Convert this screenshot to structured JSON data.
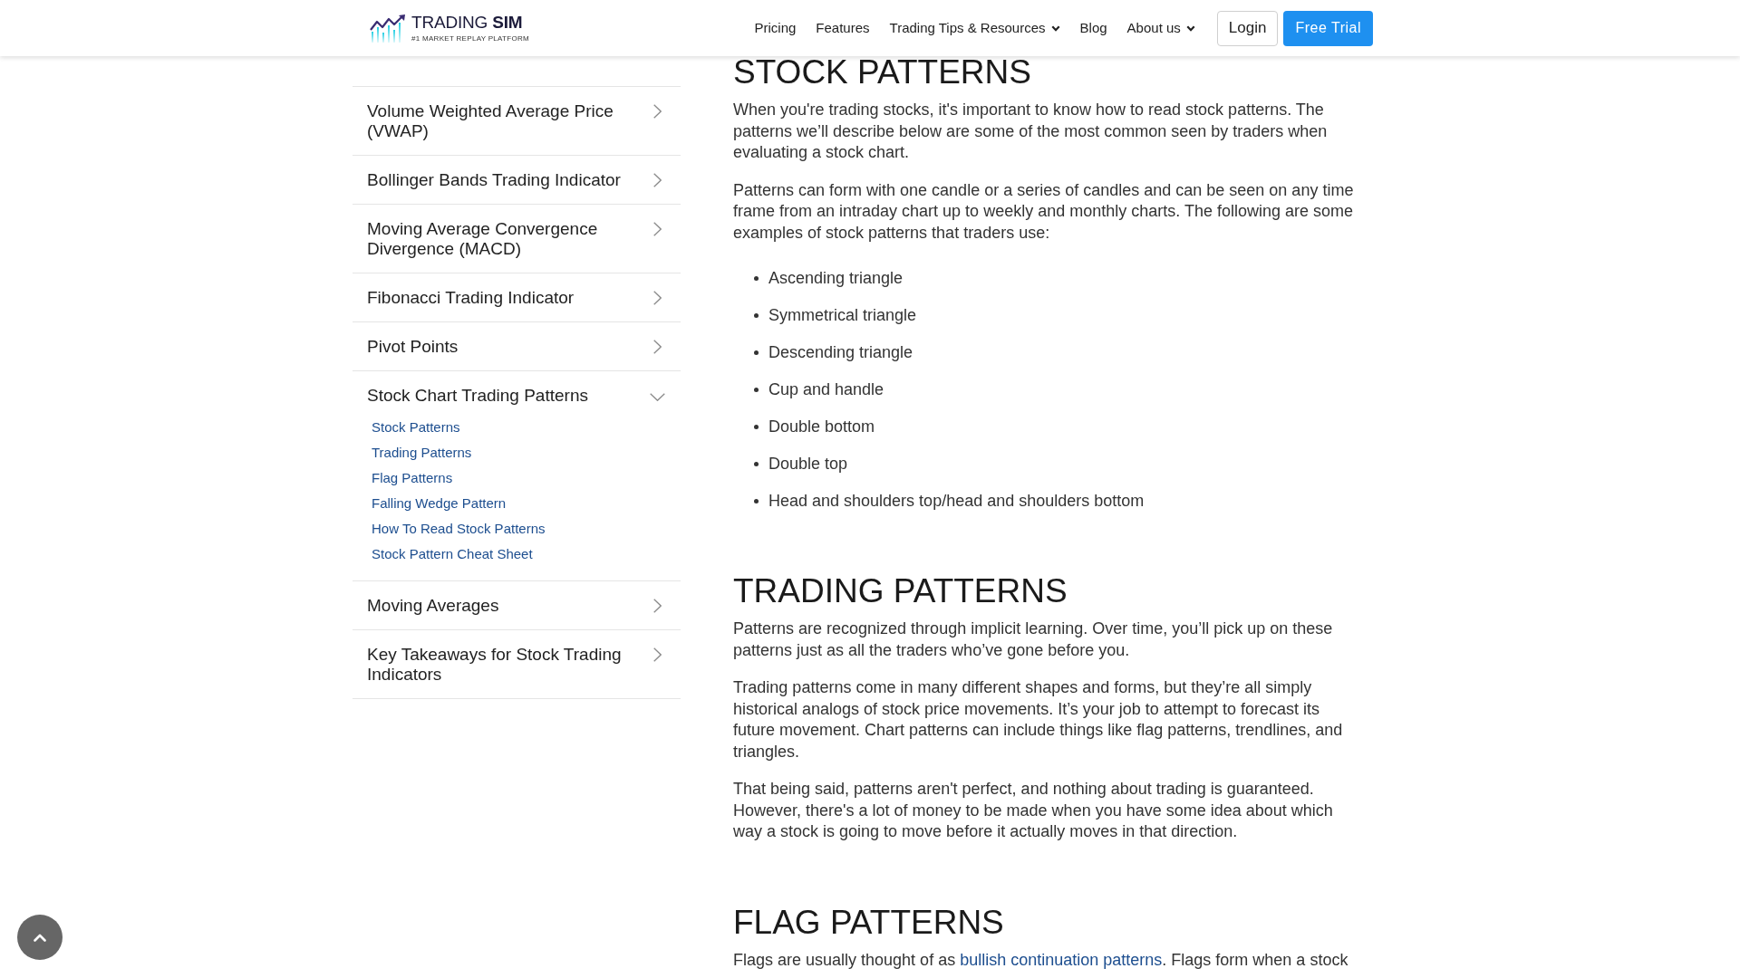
{
  "header": {
    "logo": {
      "wordmark": "TRADING **SIM**",
      "tagline": "#1 MARKET REPLAY PLATFORM"
    },
    "nav": [
      {
        "label": "Pricing",
        "kind": "link"
      },
      {
        "label": "Features",
        "kind": "link"
      },
      {
        "label": "Trading Tips & Resources",
        "kind": "dropdown"
      },
      {
        "label": "Blog",
        "kind": "link"
      },
      {
        "label": "About us",
        "kind": "dropdown"
      }
    ],
    "buttons": [
      {
        "label": "Login",
        "kind": "outline"
      },
      {
        "label": "Free Trial",
        "kind": "filled"
      }
    ]
  },
  "sidebar": {
    "items": [
      {
        "label": "Volume Weighted Average Price (VWAP)",
        "expanded": false
      },
      {
        "label": "Bollinger Bands Trading Indicator",
        "expanded": false
      },
      {
        "label": "Moving Average Convergence Divergence (MACD)",
        "expanded": false
      },
      {
        "label": "Fibonacci Trading Indicator",
        "expanded": false
      },
      {
        "label": "Pivot Points",
        "expanded": false
      },
      {
        "label": "Stock Chart Trading Patterns",
        "expanded": true,
        "children": [
          {
            "label": "Stock Patterns"
          },
          {
            "label": "Trading Patterns"
          },
          {
            "label": "Flag Patterns"
          },
          {
            "label": "Falling Wedge Pattern"
          },
          {
            "label": "How To Read Stock Patterns"
          },
          {
            "label": "Stock Pattern Cheat Sheet"
          }
        ]
      },
      {
        "label": "Moving Averages",
        "expanded": false
      },
      {
        "label": "Key Takeaways for Stock Trading Indicators",
        "expanded": false
      }
    ]
  },
  "article": {
    "sections": [
      {
        "heading": "STOCK PATTERNS",
        "blocks": [
          {
            "kind": "paragraph",
            "text": "When you're trading stocks, it's important to know how to read stock patterns. The patterns we’ll describe below are some of the most common seen by traders when evaluating a stock chart."
          },
          {
            "kind": "paragraph",
            "text": "Patterns can form with one candle or a series of candles and can be seen on any time frame from an intraday chart up to weekly and monthly charts. The following are some examples of stock patterns that traders use:"
          },
          {
            "kind": "list",
            "items": [
              "Ascending triangle",
              "Symmetrical triangle",
              "Descending triangle",
              "Cup and handle",
              "Double bottom",
              "Double top",
              "Head and shoulders top/head and shoulders bottom"
            ]
          }
        ]
      },
      {
        "heading": "TRADING PATTERNS",
        "blocks": [
          {
            "kind": "paragraph",
            "text": "Patterns are recognized through implicit learning. Over time, you’ll pick up on these patterns just as all the traders who’ve gone before you."
          },
          {
            "kind": "paragraph",
            "text": "Trading patterns come in many different shapes and forms, but they’re all simply historical analogs of stock price movements. It’s your job to attempt to forecast its future movement. Chart patterns can include things like flag patterns, trendlines, and triangles."
          },
          {
            "kind": "paragraph",
            "text": "That being said, patterns aren't perfect, and nothing about trading is guaranteed. However, there's a lot of money to be made when you have some idea about which way a stock is going to move before it actually moves in that direction."
          }
        ]
      },
      {
        "heading": "FLAG PATTERNS",
        "blocks": [
          {
            "kind": "paragraph",
            "parts": [
              {
                "kind": "text",
                "text": "Flags are usually thought of as "
              },
              {
                "kind": "link",
                "text": "bullish continuation patterns"
              },
              {
                "kind": "text",
                "text": ". Flags form when a stock"
              }
            ]
          }
        ]
      }
    ]
  }
}
